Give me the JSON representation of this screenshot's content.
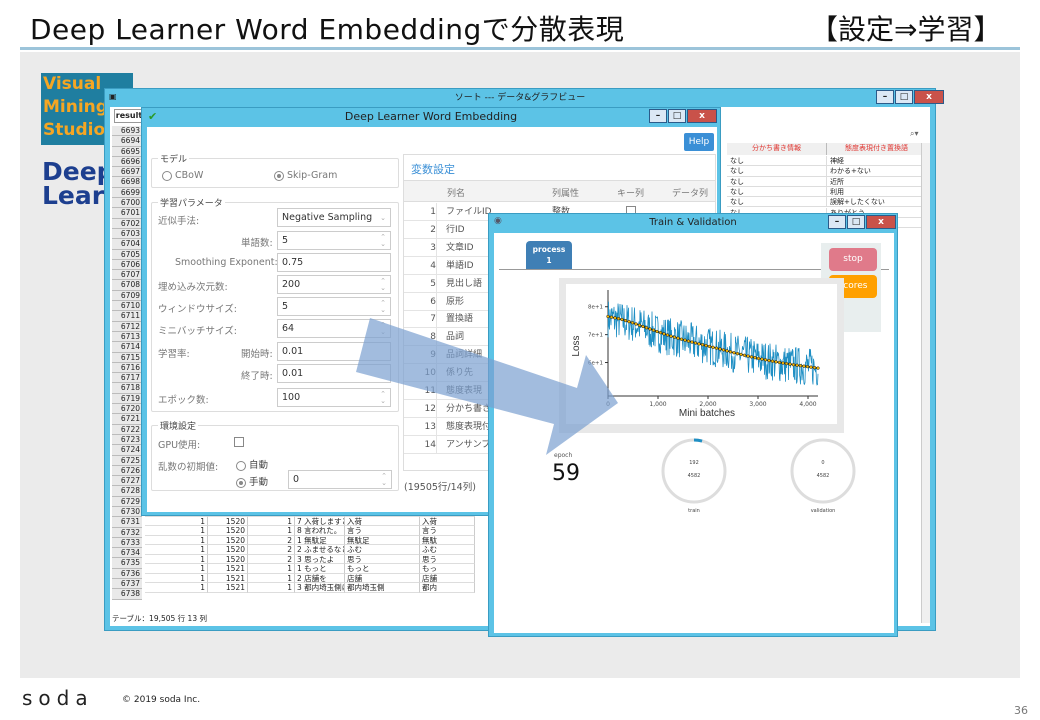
{
  "slide": {
    "title": "Deep Learner Word Embeddingで分散表現",
    "tag": "【設定⇒学習】",
    "logo_text": "Visual Mining Studio",
    "logo2_text": "Deep Learner",
    "footer_logo": "soda",
    "copyright": "© 2019 soda Inc.",
    "page": "36"
  },
  "back_window": {
    "title": "ソート --- データ&グラフビュー",
    "tab": "result",
    "row_numbers": [
      "6693",
      "6694",
      "6695",
      "6696",
      "6697",
      "6698",
      "6699",
      "6700",
      "6701",
      "6702",
      "6703",
      "6704",
      "6705",
      "6706",
      "6707",
      "6708",
      "6709",
      "6710",
      "6711",
      "6712",
      "6713",
      "6714",
      "6715",
      "6716",
      "6717",
      "6718",
      "6719",
      "6720",
      "6721",
      "6722",
      "6723",
      "6724",
      "6725",
      "6726",
      "6727",
      "6728",
      "6729",
      "6730",
      "6731",
      "6732",
      "6733",
      "6734",
      "6735",
      "6736",
      "6737",
      "6738"
    ],
    "rows": [
      [
        "1",
        "1520",
        "1",
        "6 ○○日には",
        "○○日",
        "○○"
      ],
      [
        "1",
        "1520",
        "1",
        "7 入荷しますと",
        "入荷",
        "入荷"
      ],
      [
        "1",
        "1520",
        "1",
        "8 言われた。",
        "言う",
        "言う"
      ],
      [
        "1",
        "1520",
        "2",
        "1 無駄足",
        "無駄足",
        "無駄"
      ],
      [
        "1",
        "1520",
        "2",
        "2 ふませるなと",
        "ふむ",
        "ふむ"
      ],
      [
        "1",
        "1520",
        "2",
        "3 思ったよ",
        "思う",
        "思う"
      ],
      [
        "1",
        "1521",
        "1",
        "1 もっと",
        "もっと",
        "もっ"
      ],
      [
        "1",
        "1521",
        "1",
        "2 店舗を",
        "店舗",
        "店舗"
      ],
      [
        "1",
        "1521",
        "1",
        "3 都内埼玉側に",
        "都内埼玉側",
        "都内"
      ]
    ],
    "right_headers": [
      "分かち書き情報",
      "態度表現付き置換語"
    ],
    "right_rows": [
      [
        "なし",
        "神経"
      ],
      [
        "なし",
        "わかる+ない"
      ],
      [
        "なし",
        "近所"
      ],
      [
        "なし",
        "利用"
      ],
      [
        "なし",
        "誤解+したくない"
      ],
      [
        "なし",
        "ありがとう"
      ],
      [
        "なし",
        "各店舗"
      ]
    ],
    "status": "テーブル：19,505 行 13 列"
  },
  "dialog": {
    "title": "Deep Learner Word Embedding",
    "help": "Help",
    "model_group": "モデル",
    "model_options": [
      "CBoW",
      "Skip-Gram"
    ],
    "model_selected": "Skip-Gram",
    "params_group": "学習パラメータ",
    "params": {
      "method_label": "近似手法:",
      "method": "Negative Sampling",
      "words_label": "単語数:",
      "words": "5",
      "smoothing_label": "Smoothing Exponent:",
      "smoothing": "0.75",
      "dim_label": "埋め込み次元数:",
      "dim": "200",
      "window_label": "ウィンドウサイズ:",
      "window": "5",
      "batch_label": "ミニバッチサイズ:",
      "batch": "64",
      "lr_label": "学習率:",
      "lr_start_label": "開始時:",
      "lr_start": "0.01",
      "lr_end_label": "終了時:",
      "lr_end": "0.01",
      "epochs_label": "エポック数:",
      "epochs": "100"
    },
    "env_group": "環境設定",
    "gpu_label": "GPU使用:",
    "gpu_checked": false,
    "seed_label": "乱数の初期値:",
    "seed_options": [
      "自動",
      "手動"
    ],
    "seed_selected": "手動",
    "seed_value": "0",
    "vars": {
      "title": "変数設定",
      "headers": [
        "列名",
        "列属性",
        "キー列",
        "データ列"
      ],
      "rows": [
        [
          "1",
          "ファイルID",
          "整数"
        ],
        [
          "2",
          "行ID",
          ""
        ],
        [
          "3",
          "文章ID",
          ""
        ],
        [
          "4",
          "単語ID",
          ""
        ],
        [
          "5",
          "見出し語",
          ""
        ],
        [
          "6",
          "原形",
          ""
        ],
        [
          "7",
          "置換語",
          ""
        ],
        [
          "8",
          "品詞",
          ""
        ],
        [
          "9",
          "品詞詳細",
          ""
        ],
        [
          "10",
          "係り先",
          ""
        ],
        [
          "11",
          "態度表現",
          ""
        ],
        [
          "12",
          "分かち書き",
          ""
        ],
        [
          "13",
          "態度表現付",
          ""
        ],
        [
          "14",
          "アンサンブル",
          ""
        ]
      ],
      "footer": "(19505行/14列)"
    }
  },
  "train_window": {
    "title": "Train & Validation",
    "tab": "process\n1",
    "stop": "stop",
    "scores": "scores",
    "epoch_label": "epoch",
    "epoch": "59",
    "train": {
      "value": "192",
      "total": "4582",
      "label": "train",
      "fraction": 0.042
    },
    "validation": {
      "value": "0",
      "total": "4582",
      "label": "validation",
      "fraction": 0
    }
  },
  "chart_data": {
    "type": "line",
    "xlabel": "Mini batches",
    "ylabel": "Loss",
    "xlim": [
      0,
      4200
    ],
    "ylim": [
      48,
      86
    ],
    "x_ticks": [
      0,
      1000,
      2000,
      3000,
      4000
    ],
    "x_tick_labels": [
      "0",
      "1,000",
      "2,000",
      "3,000",
      "4,000"
    ],
    "y_ticks": [
      60,
      70,
      80
    ],
    "y_tick_labels": [
      "6e+1",
      "7e+1",
      "8e+1"
    ],
    "series": [
      {
        "style": "raw",
        "color": "#1f8fc4",
        "x": [
          0,
          500,
          1000,
          1500,
          2000,
          2500,
          3000,
          3500,
          4200
        ],
        "y": [
          76,
          74,
          70.5,
          68,
          66,
          63.5,
          61.5,
          59.5,
          58
        ]
      },
      {
        "style": "smoothed",
        "color": "#f5b800",
        "x": [
          0,
          250,
          500,
          750,
          1000,
          1250,
          1500,
          1750,
          2000,
          2250,
          2500,
          2750,
          3000,
          3250,
          3500,
          3750,
          4000,
          4200
        ],
        "y": [
          76.5,
          75.6,
          74.2,
          72.6,
          71,
          69.5,
          68.2,
          67,
          65.9,
          64.8,
          63.6,
          62.5,
          61.5,
          60.6,
          59.8,
          59.1,
          58.5,
          58
        ]
      }
    ]
  },
  "colors": {
    "window_frame": "#5cc3e6",
    "help": "#3a8fd6",
    "stop": "#e07a8a",
    "scores": "#ffa000",
    "tab": "#3f7fb5",
    "arrow": "#7aa0d0"
  }
}
